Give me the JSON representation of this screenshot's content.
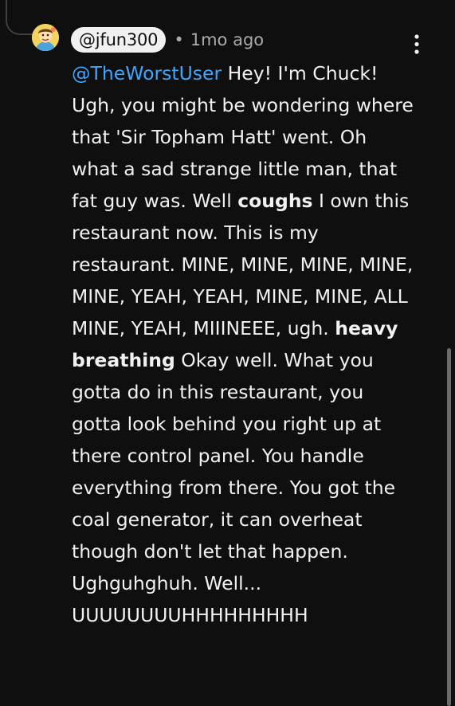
{
  "comment": {
    "author_handle": "@jfun300",
    "separator": "•",
    "timestamp": "1mo ago",
    "mention": "@TheWorstUser",
    "segments": [
      {
        "text": " Hey! I'm Chuck! Ugh, you might be wondering where that 'Sir Topham Hatt' went. Oh what a sad strange little man, that fat guy was. Well ",
        "bold": false
      },
      {
        "text": "coughs",
        "bold": true
      },
      {
        "text": " I own this restaurant now. This is my restaurant. MINE, MINE, MINE, MINE, MINE, YEAH, YEAH, MINE, MINE, ALL MINE, YEAH, MIIINEEE, ugh. ",
        "bold": false
      },
      {
        "text": "heavy breathing",
        "bold": true
      },
      {
        "text": " Okay well. What you gotta do in this restaurant, you gotta look behind you right up at there control panel. You handle everything from there. You got the coal generator, it can overheat though don't let that happen. Ughguhghuh. Well... UUUUUUUUHHHHHHHHH",
        "bold": false
      }
    ]
  },
  "icons": {
    "avatar": "cartoon-avatar-icon",
    "more": "more-vertical-icon"
  },
  "colors": {
    "background": "#0f0f0f",
    "text": "#f1f1f1",
    "mention": "#3ea6ff",
    "muted": "#aaaaaa",
    "pill": "#f1f1f1"
  }
}
